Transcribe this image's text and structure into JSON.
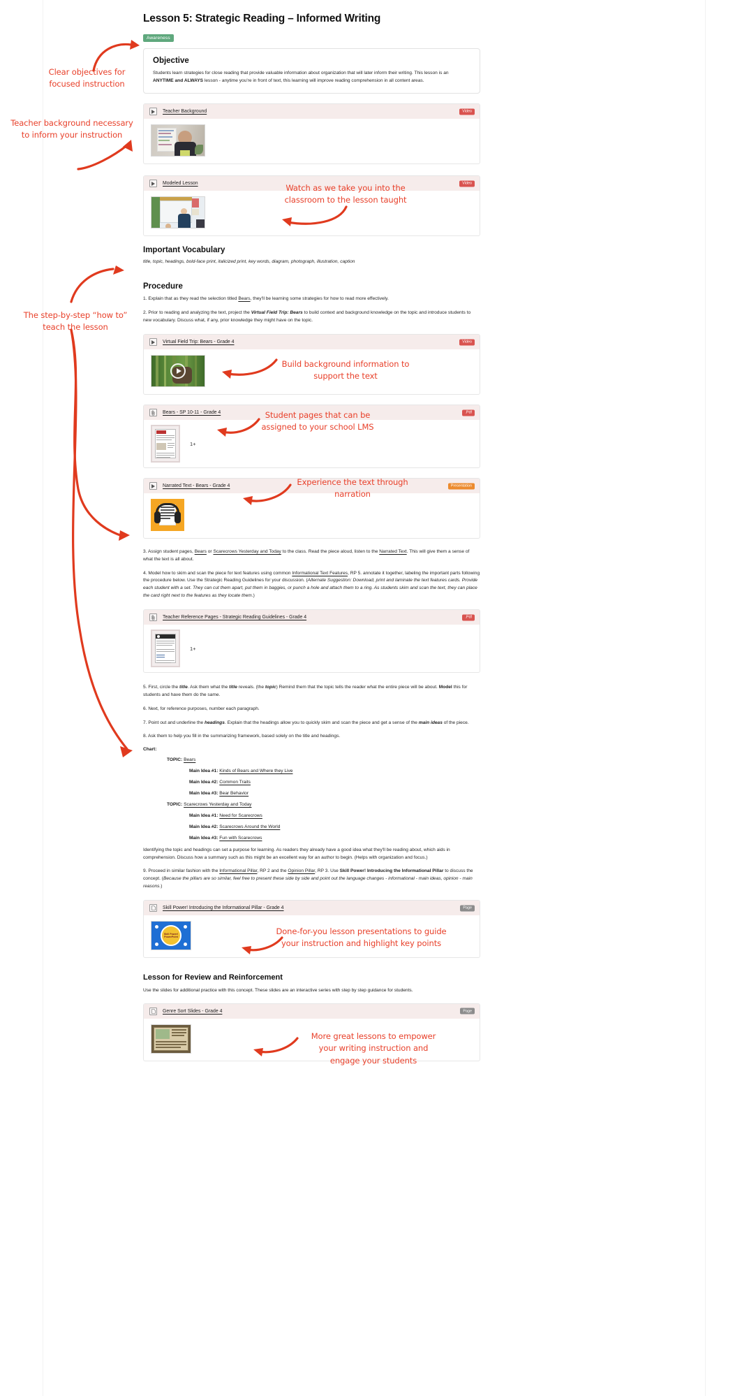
{
  "lesson": {
    "title": "Lesson 5: Strategic Reading – Informed Writing",
    "tag": "Awareness"
  },
  "objective": {
    "heading": "Objective",
    "text_1": "Students learn strategies for close reading that provide valuable information about organization that will later inform their writing. This lesson is an ",
    "bold_1": "ANYTIME and ALWAYS",
    "text_2": " lesson - anytime you're in front of text, this learning will improve reading comprehension in all content areas."
  },
  "resources": {
    "teacher_background": {
      "title": "Teacher Background",
      "badge": "Video",
      "icon": "play-icon"
    },
    "modeled_lesson": {
      "title": "Modeled Lesson",
      "badge": "Video",
      "icon": "play-icon"
    },
    "virtual_field_trip": {
      "title": "Virtual Field Trip: Bears - Grade 4",
      "badge": "Video",
      "icon": "play-icon"
    },
    "bears_sp": {
      "title": "Bears - SP 10-11 - Grade 4",
      "badge": ".Pdf",
      "icon": "paperclip-icon",
      "pages": "1+"
    },
    "narrated_text": {
      "title": "Narrated Text - Bears - Grade 4",
      "badge": "Presentation",
      "icon": "play-icon"
    },
    "teacher_reference": {
      "title": "Teacher Reference Pages - Strategic Reading Guidelines - Grade 4",
      "badge": ".Pdf",
      "icon": "paperclip-icon",
      "pages": "1+"
    },
    "skill_power": {
      "title": "Skill Power! Introducing the Informational Pillar - Grade 4",
      "badge": "Page",
      "icon": "document-icon"
    },
    "genre_sort": {
      "title": "Genre Sort Slides - Grade 4",
      "badge": "Page",
      "icon": "document-icon"
    }
  },
  "vocabulary": {
    "heading": "Important Vocabulary",
    "words": "title, topic, headings, bold-face print, italicized print, key words, diagram, photograph, illustration, caption"
  },
  "procedure": {
    "heading": "Procedure",
    "step1_a": "1. Explain that as they read the selection titled ",
    "step1_u": "Bears",
    "step1_b": ", they'll be learning some strategies for how to read more effectively.",
    "step2_a": "2. Prior to reading and analyzing the text, project the ",
    "step2_bi": "Virtual Field Trip: Bears",
    "step2_b": " to build context and background knowledge on the topic and introduce students to new vocabulary. Discuss what, if any, prior knowledge they might have on the topic.",
    "step3_a": "3. Assign student pages, ",
    "step3_u1": "Bears",
    "step3_b": " or ",
    "step3_u2": "Scarecrows Yesterday and Today",
    "step3_c": " to the class. Read the piece aloud, listen to the ",
    "step3_u3": "Narrated Text",
    "step3_d": ". This will give them a sense of what the text is all about.",
    "step4_a": "4. Model how to skim and scan the piece for text features using common ",
    "step4_u": "Informational Text Features",
    "step4_b": ", RP 5. annotate it together, labeling the important parts following the procedure below. Use the Strategic Reading Guidelines for your discussion. (",
    "step4_i": "Alternate Suggestion: Download, print and laminate the text features cards. Provide each student with a set. They can cut them apart, put them in baggies, or punch a hole and attach them to a ring. As students skim and scan the text, they can place the card right next to the features as they locate them.",
    "step4_c": ")",
    "step5_a": "5. First, circle the ",
    "step5_bi1": "title",
    "step5_b": ". Ask them what the ",
    "step5_bi2": "title",
    "step5_c": " reveals. (the ",
    "step5_bi3": "topic",
    "step5_d": ") Remind them that the topic tells the reader what the entire piece will be about. ",
    "step5_bo": "Model",
    "step5_e": " this for students and have them do the same.",
    "step6": "6. Next, for reference purposes, number each paragraph.",
    "step7_a": "7. Point out and underline the ",
    "step7_bi1": "headings",
    "step7_b": ". Explain that the headings allow you to quickly skim and scan the piece and get a sense of the ",
    "step7_bi2": "main ideas",
    "step7_c": " of the piece.",
    "step8": "8. Ask them to help you fill in the summarizing framework, based solely on the title and headings.",
    "chart_label": "Chart:",
    "closing_note": "Identifying the topic and headings can set a purpose for learning. As readers they already have a good idea what they'll be reading about, which aids in comprehension. Discuss how a summary such as this might be an excellent way for an author to begin. (Helps with organization and focus.)",
    "step9_a": "9. Proceed in similar fashion with the ",
    "step9_u1": "Informational Pillar",
    "step9_b": ", RP 2 and the ",
    "step9_u2": "Opinion Pillar",
    "step9_c": ", RP 3. Use ",
    "step9_bo": "Skill Power! Introducing the Informational Pillar",
    "step9_d": " to discuss the concept. (",
    "step9_i": "Because the pillars are so similar, feel free to present these side by side and point out the language changes - informational - main ideas, opinion - main reasons.",
    "step9_e": ")"
  },
  "chart": {
    "topic_label": "TOPIC:",
    "idea_labels": [
      "Main Idea #1:",
      "Main Idea #2:",
      "Main Idea #3:"
    ],
    "groups": [
      {
        "topic": "Bears",
        "ideas": [
          "Kinds of Bears and Where they Live",
          "Common Traits",
          "Bear Behavior"
        ]
      },
      {
        "topic": "Scarecrows Yesterday and Today",
        "ideas": [
          "Need for Scarecrows",
          "Scarecrows Around the World",
          "Fun with Scarecrows"
        ]
      }
    ]
  },
  "review": {
    "heading": "Lesson for Review and Reinforcement",
    "text": "Use the slides for additional practice with this concept. These slides are an interactive series with step by step guidance for students."
  },
  "annotations": [
    {
      "id": "a1",
      "text": "Clear objectives for\nfocused instruction"
    },
    {
      "id": "a2",
      "text": "Teacher background necessary\nto inform your instruction"
    },
    {
      "id": "a3",
      "text": "Watch as we take you into the\nclassroom to the lesson taught"
    },
    {
      "id": "a4",
      "text": "The step-by-step “how to”\nteach the lesson"
    },
    {
      "id": "a5",
      "text": "Build background information to\nsupport the text"
    },
    {
      "id": "a6",
      "text": "Student pages that can be\nassigned to your school LMS"
    },
    {
      "id": "a7",
      "text": "Experience the text through narration"
    },
    {
      "id": "a8",
      "text": "Done-for-you lesson presentations to guide\nyour instruction and highlight key points"
    },
    {
      "id": "a9",
      "text": "More great lessons to empower\nyour writing instruction and\nengage your students"
    }
  ],
  "colors": {
    "annotation": "#e8402a",
    "tag_green": "#5fa87d",
    "badge_red": "#d9534f",
    "badge_orange": "#ec8b2e",
    "badge_gray": "#8c8c8c",
    "card_header": "#f6eceb"
  }
}
